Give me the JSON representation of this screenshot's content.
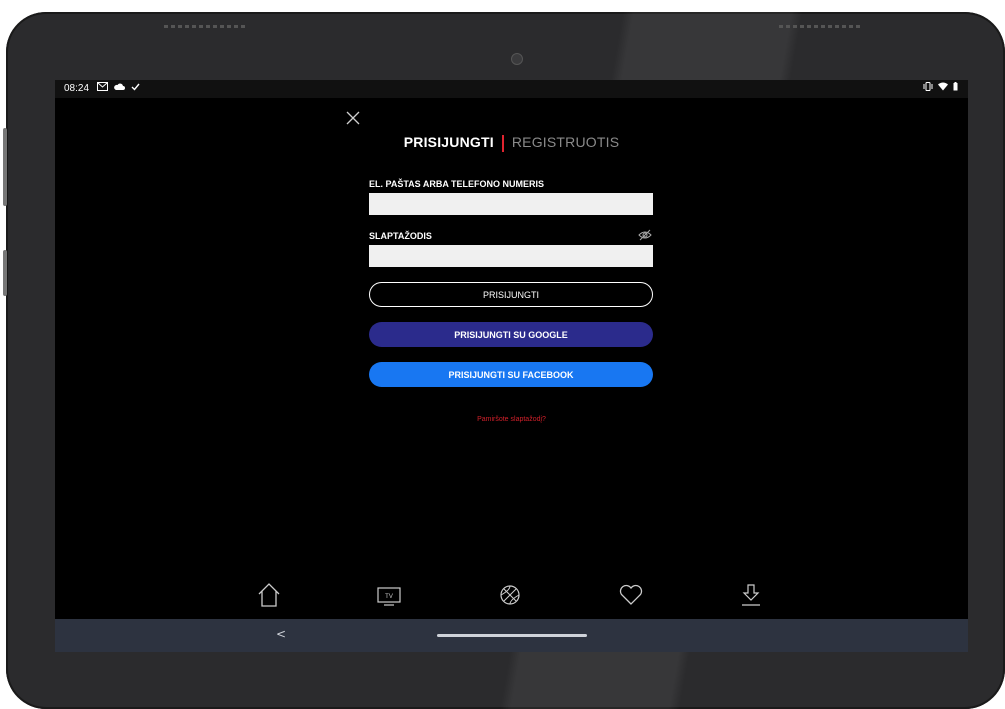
{
  "status_bar": {
    "time": "08:24",
    "left_icons": [
      "gmail-icon",
      "cloud-icon",
      "check-icon"
    ],
    "right_icons": [
      "vibrate-icon",
      "wifi-icon",
      "battery-icon"
    ]
  },
  "tabs": {
    "login": "PRISIJUNGTI",
    "register": "REGISTRUOTIS"
  },
  "form": {
    "email_label": "EL. PAŠTAS ARBA TELEFONO NUMERIS",
    "email_value": "",
    "password_label": "SLAPTAŽODIS",
    "password_value": ""
  },
  "buttons": {
    "login": "PRISIJUNGTI",
    "google": "PRISIJUNGTI SU GOOGLE",
    "facebook": "PRISIJUNGTI SU FACEBOOK"
  },
  "forgot_password": "Pamiršote slaptažodį?",
  "bottom_nav": [
    "home-icon",
    "tv-icon",
    "basketball-icon",
    "heart-icon",
    "download-icon"
  ],
  "colors": {
    "accent_red": "#e0242f",
    "google_button": "#2b2b8c",
    "facebook_button": "#1877f2",
    "system_nav": "#2d3340"
  }
}
